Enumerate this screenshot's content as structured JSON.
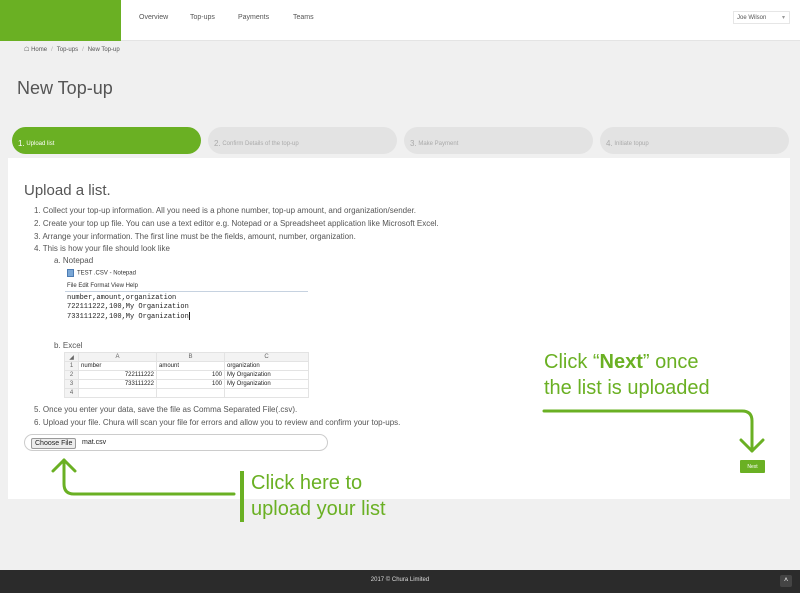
{
  "nav": {
    "items": [
      {
        "label": "Overview"
      },
      {
        "label": "Top-ups"
      },
      {
        "label": "Payments"
      },
      {
        "label": "Teams"
      }
    ],
    "user": "Joe Wilson",
    "accent": "#6ab023"
  },
  "breadcrumb": {
    "home": "Home",
    "topups": "Top-ups",
    "current": "New Top-up"
  },
  "page_title": "New Top-up",
  "steps": [
    {
      "num": "1.",
      "label": "Upload list",
      "active": true
    },
    {
      "num": "2.",
      "label": "Confirm Details of the top-up",
      "active": false
    },
    {
      "num": "3.",
      "label": "Make Payment",
      "active": false
    },
    {
      "num": "4.",
      "label": "Initiate topup",
      "active": false
    }
  ],
  "upload": {
    "heading": "Upload a list.",
    "instructions": [
      "1. Collect your top-up information. All you need is a phone number, top-up amount, and organization/sender.",
      "2. Create your top up file. You can use a text editor e.g. Notepad or a Spreadsheet application like Microsoft Excel.",
      "3. Arrange your information. The first line must be the fields, amount, number, organization.",
      "4. This is how your file should look like",
      "5. Once you enter your data, save the file as Comma Separated File(.csv).",
      "6. Upload your file. Chura will scan your file for errors and allow you to review and confirm your top-ups."
    ],
    "example_a_label": "a. Notepad",
    "example_b_label": "b. Excel",
    "notepad": {
      "window_title": "TEST .CSV - Notepad",
      "menu": "File  Edit  Format  View  Help",
      "lines": [
        "number,amount,organization",
        "722111222,100,My Organization",
        "733111222,100,My Organization"
      ]
    },
    "excel": {
      "columns": [
        "A",
        "B",
        "C"
      ],
      "rows": [
        {
          "n": "1",
          "a": "number",
          "b": "amount",
          "c": "organization"
        },
        {
          "n": "2",
          "a": "722111222",
          "b": "100",
          "c": "My Organization"
        },
        {
          "n": "3",
          "a": "733111222",
          "b": "100",
          "c": "My Organization"
        },
        {
          "n": "4",
          "a": "",
          "b": "",
          "c": ""
        }
      ]
    },
    "choose_file_label": "Choose File",
    "file_name": "mat.csv",
    "next_label": "Next"
  },
  "callouts": {
    "next_pre": "Click “",
    "next_bold": "Next",
    "next_post": "” once",
    "next_line2": "the list is uploaded",
    "upload_line1": "Click here to",
    "upload_line2": "upload your list"
  },
  "footer": {
    "text": "2017 © Chura Limited"
  }
}
